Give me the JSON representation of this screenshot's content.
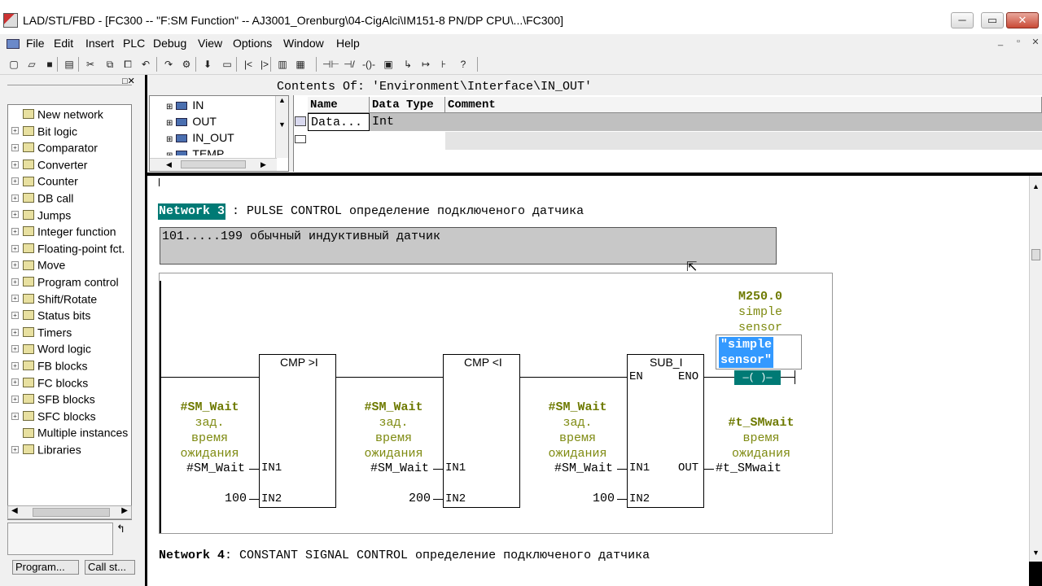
{
  "window": {
    "title": "LAD/STL/FBD  - [FC300 -- \"F:SM Function\" -- AJ3001_Orenburg\\04-CigAlci\\IM151-8 PN/DP CPU\\...\\FC300]",
    "controls": {
      "minimize": "─",
      "maximize": "▭",
      "close": "✕"
    }
  },
  "menu": {
    "items": [
      "File",
      "Edit",
      "Insert",
      "PLC",
      "Debug",
      "View",
      "Options",
      "Window",
      "Help"
    ],
    "mdi": {
      "minimize": "_",
      "restore": "▫",
      "close": "✕"
    }
  },
  "toolbar": {
    "icons": [
      "new-icon",
      "open-icon",
      "save-icon",
      "print-icon",
      "cut-icon",
      "copy-icon",
      "paste-icon",
      "undo-icon",
      "redo-icon",
      "monitor-icon",
      "download-icon",
      "overview-icon",
      "prev-icon",
      "next-icon",
      "catalog-icon",
      "network-icon",
      "contact-no-icon",
      "contact-nc-icon",
      "coil-icon",
      "box-icon",
      "branch-open-icon",
      "branch-close-icon",
      "connection-icon",
      "help-icon"
    ],
    "glyphs": [
      "▢",
      "▱",
      "■",
      "▤",
      "✂",
      "⧉",
      "⧠",
      "↶",
      "↷",
      "⚙",
      "⬇",
      "▭",
      "|<",
      "|>",
      "▥",
      "▦",
      "⊣⊢",
      "⊣/⊢",
      "-()-",
      "▣",
      "↳",
      "↦",
      "⊦",
      "?"
    ]
  },
  "catalog": {
    "items": [
      {
        "label": "New network",
        "expand": false
      },
      {
        "label": "Bit logic",
        "expand": true
      },
      {
        "label": "Comparator",
        "expand": true
      },
      {
        "label": "Converter",
        "expand": true
      },
      {
        "label": "Counter",
        "expand": true
      },
      {
        "label": "DB call",
        "expand": true
      },
      {
        "label": "Jumps",
        "expand": true
      },
      {
        "label": "Integer function",
        "expand": true
      },
      {
        "label": "Floating-point fct.",
        "expand": true
      },
      {
        "label": "Move",
        "expand": true
      },
      {
        "label": "Program control",
        "expand": true
      },
      {
        "label": "Shift/Rotate",
        "expand": true
      },
      {
        "label": "Status bits",
        "expand": true
      },
      {
        "label": "Timers",
        "expand": true
      },
      {
        "label": "Word logic",
        "expand": true
      },
      {
        "label": "FB blocks",
        "expand": true
      },
      {
        "label": "FC blocks",
        "expand": true
      },
      {
        "label": "SFB blocks",
        "expand": true
      },
      {
        "label": "SFC blocks",
        "expand": true
      },
      {
        "label": "Multiple instances",
        "expand": false
      },
      {
        "label": "Libraries",
        "expand": true
      }
    ],
    "tabs": [
      "Program...",
      "Call st..."
    ]
  },
  "interface": {
    "contents_label": "Contents Of: 'Environment\\Interface\\IN_OUT'",
    "tree": [
      "IN",
      "OUT",
      "IN_OUT",
      "TEMP"
    ],
    "columns": [
      "Name",
      "Data Type",
      "Comment"
    ],
    "rows": [
      {
        "name": "Data...",
        "type": "Int",
        "comment": ""
      }
    ]
  },
  "network3": {
    "label": "Network 3",
    "title": ": PULSE CONTROL определение подключеного датчика",
    "comment": "101.....199 обычный индуктивный датчик",
    "blocks": [
      {
        "title": "CMP >I",
        "in1_label": "IN1",
        "in2_label": "IN2",
        "operand_symbol": "#SM_Wait",
        "operand_comment1": "зад.",
        "operand_comment2": "время",
        "operand_comment3": "ожидания",
        "in1_value": "#SM_Wait",
        "in2_value": "100"
      },
      {
        "title": "CMP <I",
        "in1_label": "IN1",
        "in2_label": "IN2",
        "operand_symbol": "#SM_Wait",
        "operand_comment1": "зад.",
        "operand_comment2": "время",
        "operand_comment3": "ожидания",
        "in1_value": "#SM_Wait",
        "in2_value": "200"
      },
      {
        "title": "SUB_I",
        "en": "EN",
        "eno": "ENO",
        "in1_label": "IN1",
        "in2_label": "IN2",
        "out_label": "OUT",
        "operand_symbol": "#SM_Wait",
        "operand_comment1": "зад.",
        "operand_comment2": "время",
        "operand_comment3": "ожидания",
        "in1_value": "#SM_Wait",
        "in2_value": "100"
      }
    ],
    "out_operand": {
      "symbol": "#t_SMwait",
      "comment1": "время",
      "comment2": "ожидания",
      "value": "#t_SMwait"
    },
    "coil": {
      "address": "M250.0",
      "comment1": "simple",
      "comment2": "sensor",
      "edit_text": "\"simple\nsensor\"",
      "symbol": "—( )—"
    }
  },
  "network4": {
    "label": "Network 4",
    "title": ": CONSTANT SIGNAL CONTROL определение подключеного датчика"
  }
}
